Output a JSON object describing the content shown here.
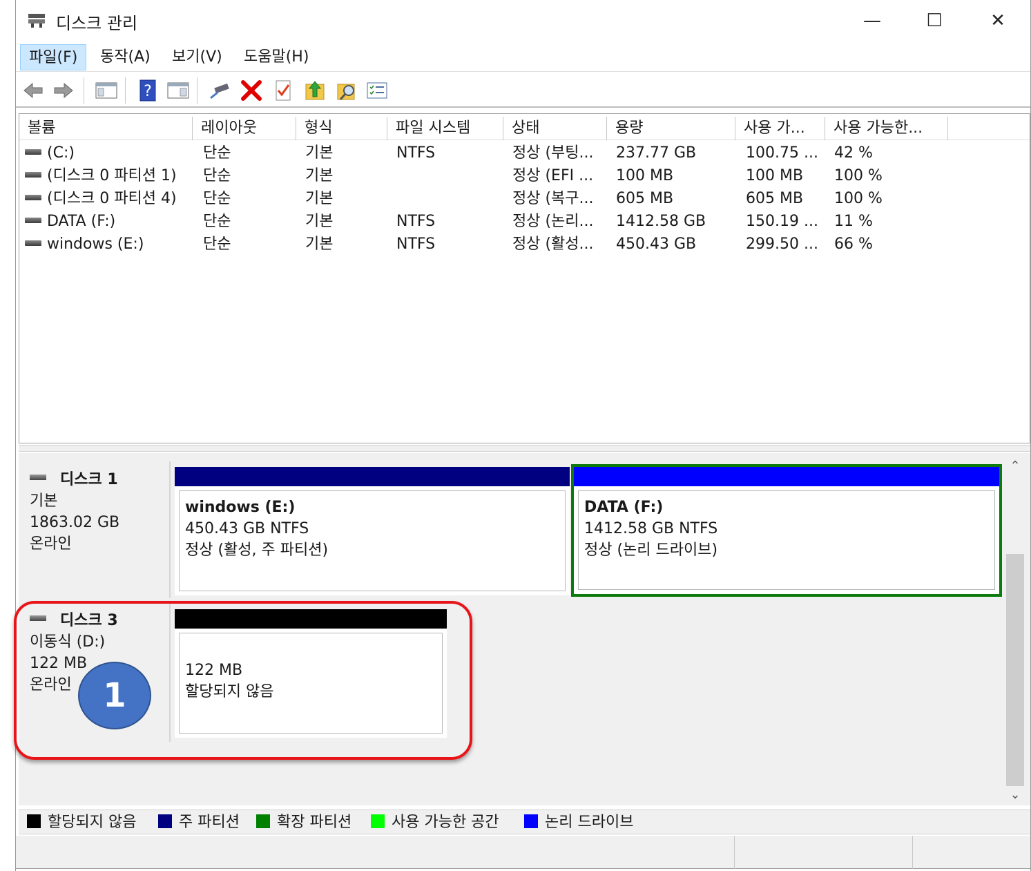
{
  "window": {
    "title": "디스크 관리",
    "buttons": {
      "minimize": "—",
      "maximize": "☐",
      "close": "✕"
    }
  },
  "menu": [
    "파일(F)",
    "동작(A)",
    "보기(V)",
    "도움말(H)"
  ],
  "toolbar": [
    "back-arrow-icon",
    "forward-arrow-icon",
    "show-hide-console-tree-icon",
    "help-icon",
    "properties-pane-icon",
    "connect-disk-icon",
    "delete-icon",
    "check-icon",
    "import-icon",
    "search-icon",
    "settings-list-icon"
  ],
  "volume_table": {
    "headers": [
      "볼륨",
      "레이아웃",
      "형식",
      "파일 시스템",
      "상태",
      "용량",
      "사용 가...",
      "사용 가능한..."
    ],
    "rows": [
      [
        "(C:)",
        "단순",
        "기본",
        "NTFS",
        "정상 (부팅...",
        "237.77 GB",
        "100.75 ...",
        "42 %"
      ],
      [
        "(디스크 0 파티션 1)",
        "단순",
        "기본",
        "",
        "정상 (EFI ...",
        "100 MB",
        "100 MB",
        "100 %"
      ],
      [
        "(디스크 0 파티션 4)",
        "단순",
        "기본",
        "",
        "정상 (복구...",
        "605 MB",
        "605 MB",
        "100 %"
      ],
      [
        "DATA (F:)",
        "단순",
        "기본",
        "NTFS",
        "정상 (논리...",
        "1412.58 GB",
        "150.19 ...",
        "11 %"
      ],
      [
        "windows (E:)",
        "단순",
        "기본",
        "NTFS",
        "정상 (활성...",
        "450.43 GB",
        "299.50 ...",
        "66 %"
      ]
    ]
  },
  "disks": [
    {
      "name": "디스크 1",
      "type": "기본",
      "size": "1863.02 GB",
      "status": "온라인",
      "partitions": [
        {
          "title": "windows  (E:)",
          "size": "450.43 GB NTFS",
          "status": "정상 (활성, 주 파티션)",
          "bar_color": "#000080"
        },
        {
          "title": "DATA  (F:)",
          "size": "1412.58 GB NTFS",
          "status": "정상 (논리 드라이브)",
          "bar_color": "#0000ff"
        }
      ]
    },
    {
      "name": "디스크 3",
      "type": "이동식 (D:)",
      "size": "122 MB",
      "status": "온라인",
      "partitions": [
        {
          "title": "",
          "size": "122 MB",
          "status": "할당되지 않음",
          "bar_color": "#000000"
        }
      ]
    }
  ],
  "legend": [
    {
      "label": "할당되지 않음",
      "color": "#000000"
    },
    {
      "label": "주 파티션",
      "color": "#000080"
    },
    {
      "label": "확장 파티션",
      "color": "#008000"
    },
    {
      "label": "사용 가능한 공간",
      "color": "#00ff00"
    },
    {
      "label": "논리 드라이브",
      "color": "#0000ff"
    }
  ],
  "callout": {
    "number": "1",
    "highlight_color": "#e8141a",
    "badge_color": "#4472c4"
  }
}
